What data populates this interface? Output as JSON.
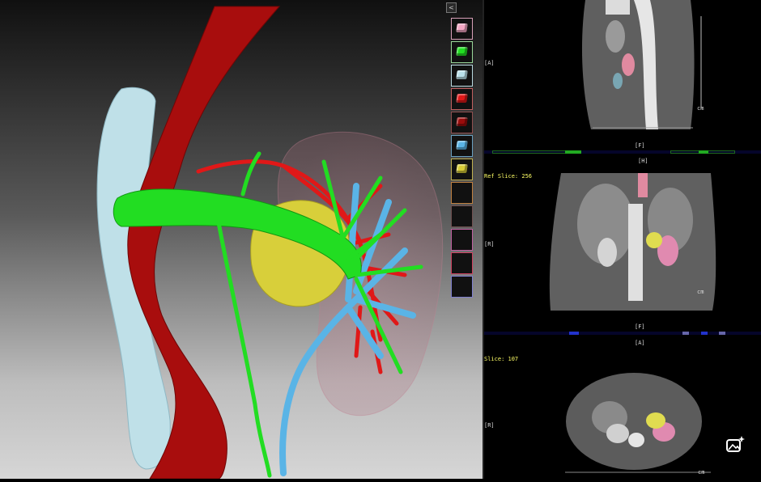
{
  "viewer": {
    "collapse_label": "<",
    "structure_swatches": [
      {
        "name": "kidney",
        "color": "#f4a7c4"
      },
      {
        "name": "renal-vein",
        "color": "#22dd22"
      },
      {
        "name": "ivc",
        "color": "#b9e0ea"
      },
      {
        "name": "renal-artery",
        "color": "#e01818"
      },
      {
        "name": "aorta",
        "color": "#9a0c0c"
      },
      {
        "name": "collecting-system",
        "color": "#5ab4e6"
      },
      {
        "name": "tumor",
        "color": "#d8cc38"
      },
      {
        "name": "empty-1",
        "color": ""
      },
      {
        "name": "empty-2",
        "color": ""
      },
      {
        "name": "empty-3",
        "color": ""
      },
      {
        "name": "empty-4",
        "color": ""
      },
      {
        "name": "empty-5",
        "color": ""
      }
    ],
    "swatch_border_colors": [
      "#d8a0b8",
      "#9ad89a",
      "#b9d9e0",
      "#c06060",
      "#905050",
      "#6aa0c0",
      "#c0b050",
      "#c08040",
      "#705050",
      "#c060a0",
      "#d04060",
      "#8080d0"
    ]
  },
  "panels": {
    "sagittal": {
      "left_label": "[A]",
      "bottom_label": "[F]",
      "unit": "cm"
    },
    "coronal": {
      "top_label": "[H]",
      "ref_slice": "Ref Slice: 256",
      "left_label": "[R]",
      "bottom_label": "[F]",
      "unit": "cm"
    },
    "axial": {
      "top_label": "[A]",
      "slice": "Slice: 107",
      "left_label": "[R]",
      "unit": "cm"
    }
  }
}
